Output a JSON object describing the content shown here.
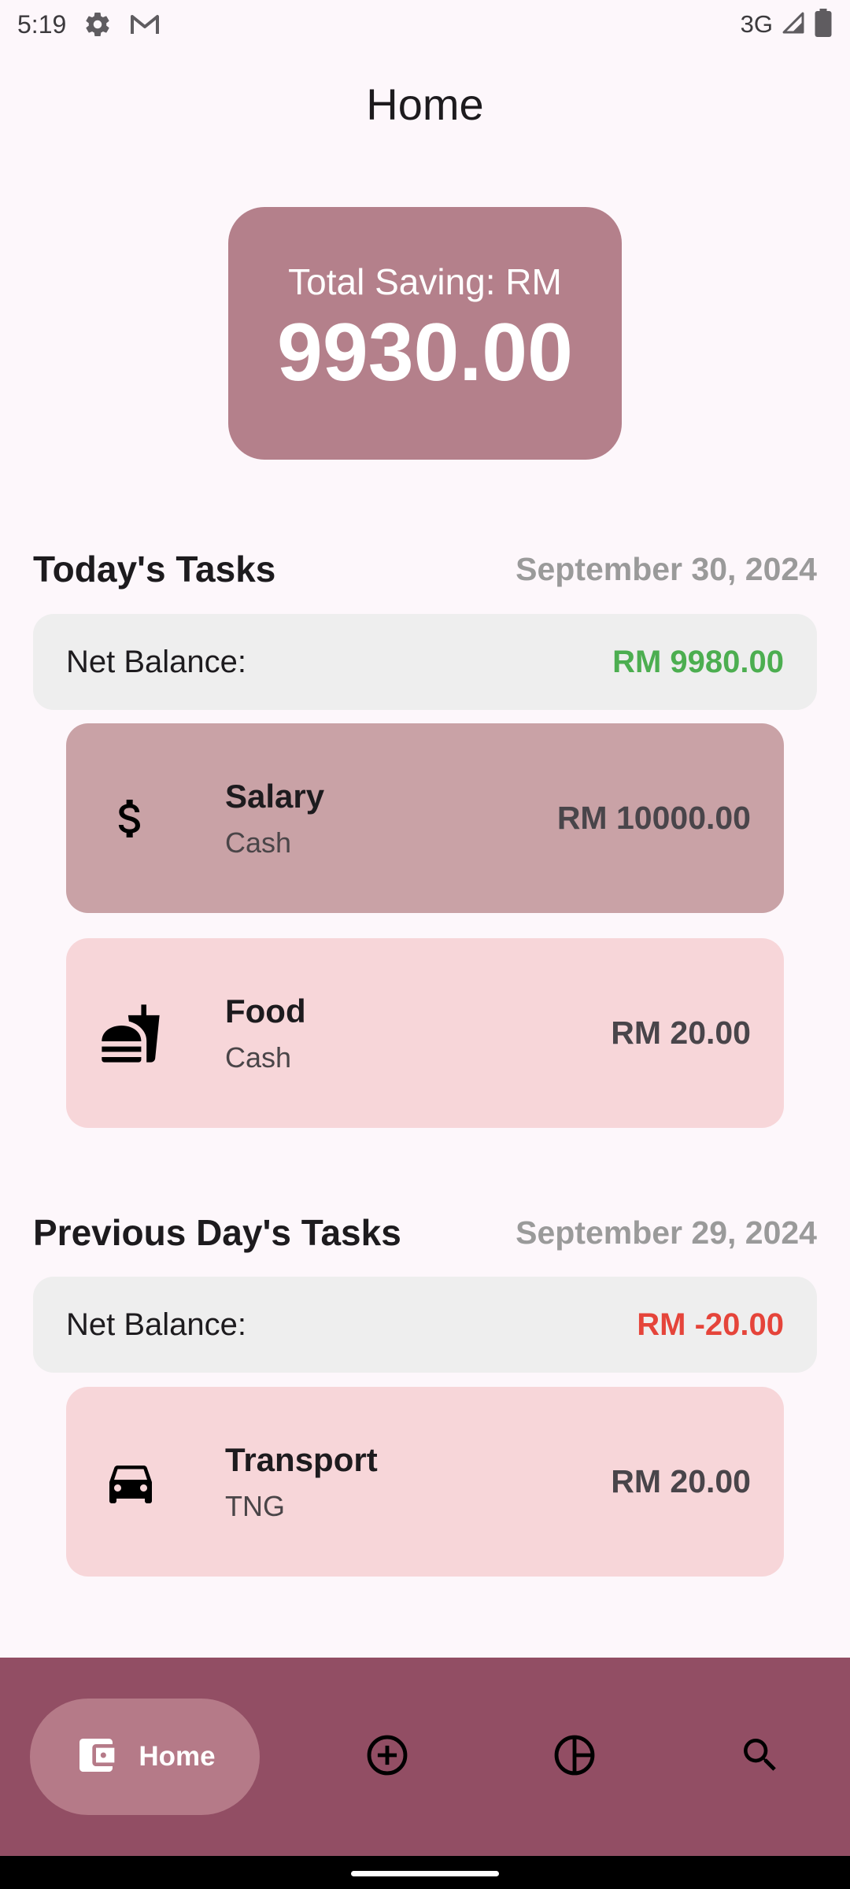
{
  "status_bar": {
    "time": "5:19",
    "network": "3G",
    "icons": [
      "gear-icon",
      "gmail-icon",
      "signal-icon",
      "battery-icon"
    ]
  },
  "page": {
    "title": "Home"
  },
  "saving": {
    "label": "Total Saving: RM",
    "amount": "9930.00"
  },
  "today": {
    "title": "Today's Tasks",
    "date": "September 30, 2024",
    "net_label": "Net Balance:",
    "net_value": "RM 9980.00",
    "tasks": [
      {
        "icon": "dollar-icon",
        "name": "Salary",
        "account": "Cash",
        "amount": "RM 10000.00"
      },
      {
        "icon": "fastfood-icon",
        "name": "Food",
        "account": "Cash",
        "amount": "RM 20.00"
      }
    ]
  },
  "previous": {
    "title": "Previous Day's Tasks",
    "date": "September 29, 2024",
    "net_label": "Net Balance:",
    "net_value": "RM -20.00",
    "tasks": [
      {
        "icon": "car-icon",
        "name": "Transport",
        "account": "TNG",
        "amount": "RM 20.00"
      }
    ]
  },
  "nav": {
    "home_label": "Home",
    "items": [
      "wallet-icon",
      "add-circle-icon",
      "pie-chart-icon",
      "search-icon"
    ]
  },
  "colors": {
    "accent": "#924e64",
    "saving_card": "#b4808b",
    "income_card": "#c9a2a6",
    "expense_card": "#f7d6d9",
    "positive": "#4cae50",
    "negative": "#e5443a"
  }
}
